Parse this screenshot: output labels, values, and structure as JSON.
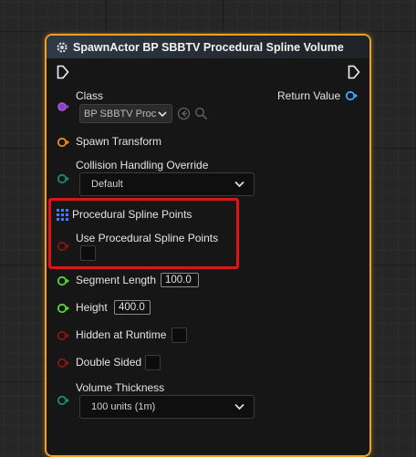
{
  "node": {
    "title": "SpawnActor BP SBBTV Procedural Spline Volume",
    "header_icon": "gear-icon",
    "border_color": "#f0a020"
  },
  "pins": {
    "class": {
      "label": "Class",
      "value": "BP SBBTV Proc",
      "color": "#8e3fbf"
    },
    "return_value": {
      "label": "Return Value",
      "color": "#3fa9ff"
    },
    "spawn_transform": {
      "label": "Spawn Transform",
      "color": "#f08a1a"
    },
    "collision": {
      "label": "Collision Handling Override",
      "value": "Default",
      "color": "#1a8a7a"
    },
    "spline_points": {
      "label": "Procedural Spline Points",
      "color": "#3f7fff"
    },
    "use_spline_points": {
      "label": "Use Procedural Spline Points",
      "color": "#8a1414"
    },
    "segment_length": {
      "label": "Segment Length",
      "value": "100.0",
      "color": "#5ad43a"
    },
    "height": {
      "label": "Height",
      "value": "400.0",
      "color": "#5ad43a"
    },
    "hidden": {
      "label": "Hidden at Runtime",
      "color": "#8a1414"
    },
    "double_sided": {
      "label": "Double Sided",
      "color": "#8a1414"
    },
    "volume_thickness": {
      "label": "Volume Thickness",
      "value": "100 units (1m)",
      "color": "#1a8a7a"
    }
  },
  "highlight_color": "#e01414"
}
